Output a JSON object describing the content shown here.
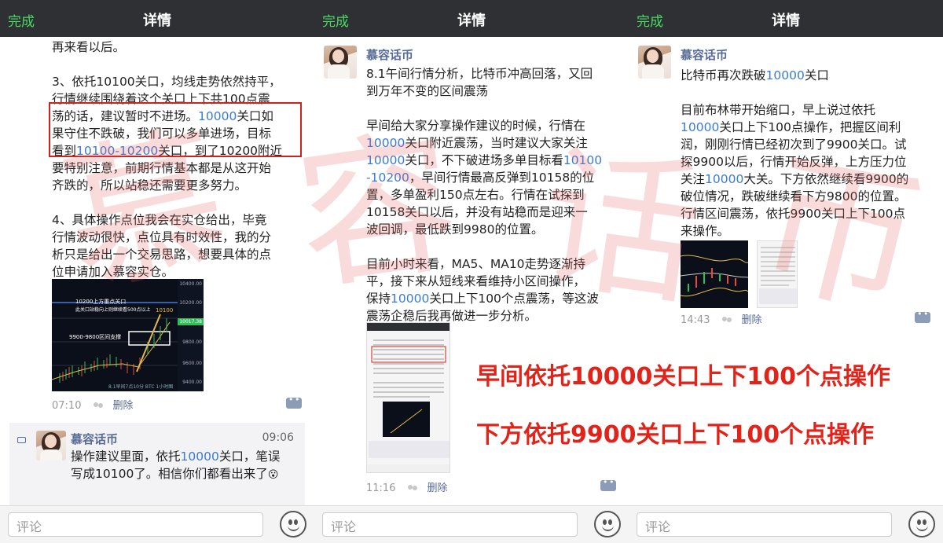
{
  "nav": {
    "done_label": "完成",
    "title": "详情"
  },
  "comment": {
    "placeholder": "评论"
  },
  "panel1": {
    "lines": [
      "再来看以后。",
      "3、依托10100关口，均线走势依然持平，",
      "行情继续围绕着这个关口上下共100点震",
      "荡的话，建议暂时不进场。",
      "10000",
      "关口如",
      "果守住不跌破，我们可以多单进场，目标",
      "看到",
      "10100-10200",
      "关口，到了10200附近",
      "要特别注意，前期行情基本都是从这开始",
      "齐跌的，所以站稳还需要更多努力。",
      "4、具体操作点位我会在实仓给出，毕竟",
      "行情波动很快，点位具有时效性，我的分",
      "析只是给出一个交易思路，想要具体的点",
      "位申请加入慕容实仓。"
    ],
    "chart": {
      "price_labels": [
        "10400.00",
        "10200.00",
        "10017.38",
        "9800.00",
        "9600.00",
        "9400.00"
      ],
      "note1": "10200上方重点关口",
      "note2": "此关口站稳向上则继续看500点以上",
      "note3": "10100",
      "box_label": "9900-9800区间支撑",
      "footer": "8.1早间7点10分 BTC 1小时图"
    },
    "time": "07:10",
    "delete_label": "删除",
    "reply": {
      "name": "慕容话币",
      "time": "09:06",
      "text1": "操作建议里面，依托",
      "hl": "10000",
      "text2": "关口，笔误",
      "text3": "写成10100了。相信你们都看出来了",
      "emoji": "😮"
    }
  },
  "panel2": {
    "name": "慕容话币",
    "lines": [
      "8.1午间行情分析，比特币冲高回落，又回",
      "到万年不变的区间震荡",
      "早间给大家分享操作建议的时候，行情在",
      "关口附近震荡，当时建议大家关注",
      "关口，不下破进场多单目标看",
      "，早间行情最高反弹到10158的位",
      "置，多单盈利150点左右。行情在试探到",
      "10158关口以后，并没有站稳而是迎来一",
      "波回调，最低跌到9980的位置。",
      "目前小时来看，MA5、MA10走势逐渐持",
      "平，接下来从短线来看维持小区间操作，",
      "保持",
      "关口上下100个点震荡，等这波",
      "震荡企稳后我再做进一步分析。"
    ],
    "hl": {
      "a": "10000",
      "b": "10000",
      "c": "10100",
      "d": "-10200",
      "e": "10000"
    },
    "time": "11:16",
    "delete_label": "删除"
  },
  "panel3": {
    "name": "慕容话币",
    "line1a": "比特币再次跌破",
    "line1b": "10000",
    "line1c": "关口",
    "lines": [
      "目前布林带开始缩口，早上说过依托",
      "关口上下100点操作，把握区间利",
      "润，刚刚行情已经初次到了9900关口。试",
      "探9900以后，行情开始反弹，上方压力位",
      "关注",
      "大关。下方依然继续看9900的",
      "破位情况，跌破继续看下方9800的位置。",
      "行情区间震荡，依托9900关口上下100点",
      "来操作。"
    ],
    "hl": "10000",
    "time": "14:43",
    "delete_label": "删除"
  },
  "overlay": {
    "line1": "早间依托10000关口上下100个点操作",
    "line2": "下方依托9900关口上下100个点操作"
  },
  "watermark": [
    "慕",
    "容",
    "话",
    "币"
  ]
}
